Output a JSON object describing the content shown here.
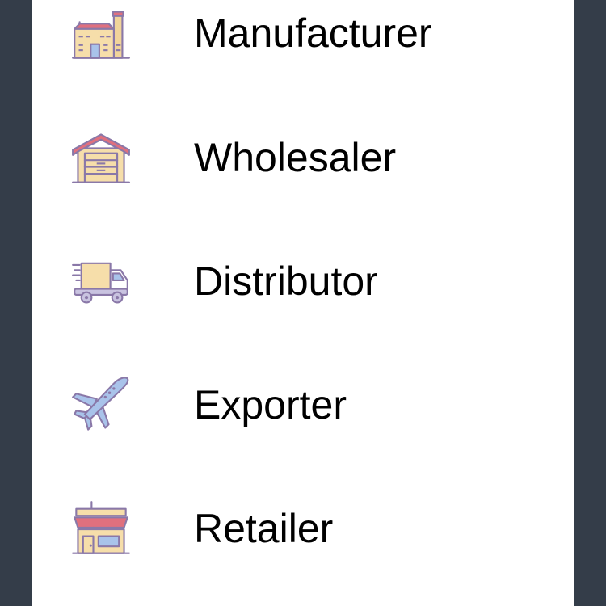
{
  "menu": {
    "items": [
      {
        "label": "Manufacturer",
        "icon": "factory-icon"
      },
      {
        "label": "Wholesaler",
        "icon": "warehouse-icon"
      },
      {
        "label": "Distributor",
        "icon": "delivery-truck-icon"
      },
      {
        "label": "Exporter",
        "icon": "airplane-icon"
      },
      {
        "label": "Retailer",
        "icon": "shop-icon"
      }
    ]
  },
  "colors": {
    "background": "#343d49",
    "panel": "#ffffff",
    "text": "#000000",
    "icon_outline": "#8a78a8",
    "icon_red": "#e0707e",
    "icon_cream": "#f6deaa",
    "icon_blue": "#a9c3ea"
  }
}
